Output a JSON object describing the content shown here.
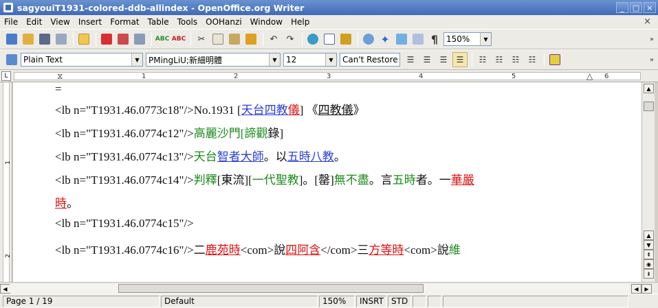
{
  "window": {
    "title": "sagyouiT1931-colored-ddb-allindex - OpenOffice.org Writer",
    "buttons": [
      "_",
      "□",
      "×"
    ]
  },
  "menu": {
    "items": [
      "File",
      "Edit",
      "View",
      "Insert",
      "Format",
      "Table",
      "Tools",
      "OOHanzi",
      "Window",
      "Help"
    ],
    "close": "×"
  },
  "toolbar": {
    "zoom": "150%"
  },
  "format_toolbar": {
    "style": "Plain Text",
    "font": "PMingLiU;新細明體",
    "size": "12",
    "restore": "Can't Restore"
  },
  "ruler": {
    "numbers": [
      "1",
      "2",
      "3",
      "4",
      "5",
      "6"
    ]
  },
  "vruler": {
    "numbers": [
      "1",
      "2"
    ]
  },
  "document": {
    "line0": "=",
    "line1": {
      "tag": "<lb n=\"T1931.46.0773c18\"/>No.1931 [",
      "a": "天台四教",
      "b": "儀",
      "c": "] 《",
      "d": "四教儀",
      "e": "》"
    },
    "line2": {
      "tag": "<lb n=\"T1931.46.0774c12\"/>",
      "a": "高麗沙門[諦觀",
      "b": "錄]"
    },
    "line3": {
      "tag": "<lb n=\"T1931.46.0774c13\"/>",
      "a": "天台",
      "b": "智者大師",
      "c": "。以",
      "d": "五時八教",
      "e": "。"
    },
    "line4": {
      "tag": "<lb n=\"T1931.46.0774c14\"/>",
      "a": "判釋",
      "b": "[東流][",
      "c": "一代聖教",
      "d": "]。[罄]",
      "e": "無不盡",
      "f": "。言",
      "g": "五時",
      "h": "者。一",
      "i": "華嚴"
    },
    "line5": {
      "a": "時",
      "b": "。"
    },
    "line6": {
      "tag": "<lb n=\"T1931.46.0774c15\"/>"
    },
    "line7": {
      "tag": "<lb n=\"T1931.46.0774c16\"/>二",
      "a": "鹿苑時",
      "b": "<com>說",
      "c": "四阿含",
      "d": "</com>三",
      "e": "方等時",
      "f": "<com>說",
      "g": "維"
    }
  },
  "status": {
    "page": "Page 1 / 19",
    "style": "Default",
    "zoom": "150%",
    "insert": "INSRT",
    "select": "STD"
  }
}
